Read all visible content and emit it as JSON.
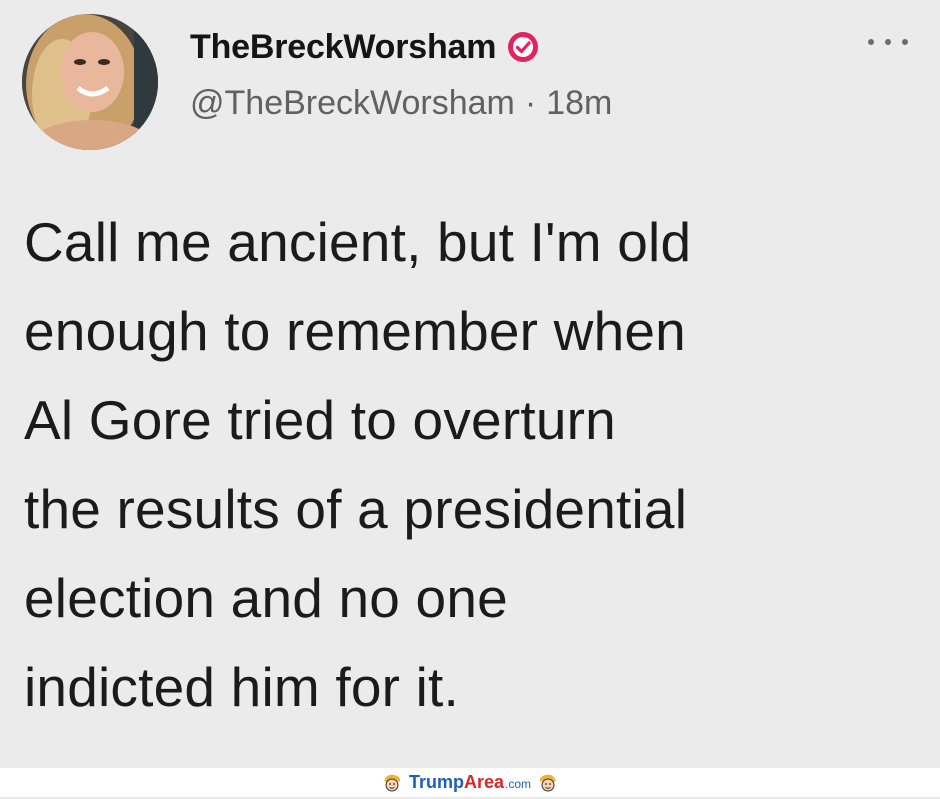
{
  "tweet": {
    "display_name": "TheBreckWorsham",
    "handle": "@TheBreckWorsham",
    "separator": "·",
    "time": "18m",
    "verified_icon": "verified-badge-icon",
    "more_icon": "more-options-icon",
    "body_lines": [
      "Call me ancient, but I'm old",
      "enough to remember when",
      "Al Gore tried to overturn",
      "the results of a presidential",
      "election and no one",
      "indicted him for it."
    ],
    "colors": {
      "verified_badge": "#e0245e",
      "text": "#1b1b1b",
      "handle": "#616161",
      "background": "#ebebeb"
    }
  },
  "footer": {
    "brand_part1": "Trump",
    "brand_part2": "Area",
    "brand_tld": ".com",
    "colors": {
      "brand_blue": "#1f5fb7",
      "brand_red": "#d8262b"
    }
  }
}
